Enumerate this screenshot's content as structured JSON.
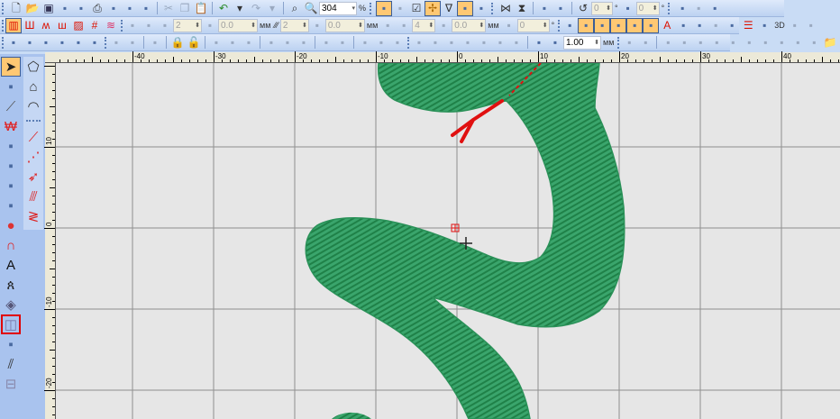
{
  "toolbars": [
    [
      {
        "g": 1
      },
      {
        "i": "new-file-icon"
      },
      {
        "i": "open-folder-icon"
      },
      {
        "i": "save-icon"
      },
      {
        "i": "export-icon"
      },
      {
        "i": "import-icon"
      },
      {
        "i": "print-icon"
      },
      {
        "i": "print-preview-icon"
      },
      {
        "i": "properties-icon"
      },
      {
        "i": "stitch-list-icon"
      },
      {
        "s": 1
      },
      {
        "i": "cut-icon",
        "d": 1
      },
      {
        "i": "copy-icon",
        "d": 1
      },
      {
        "i": "paste-icon",
        "d": 1
      },
      {
        "s": 1
      },
      {
        "i": "undo-icon"
      },
      {
        "i": "dropdown-arrow-icon"
      },
      {
        "i": "redo-icon",
        "d": 1
      },
      {
        "i": "dropdown-arrow-icon",
        "d": 1
      },
      {
        "s": 1
      },
      {
        "i": "zoom-fit-icon"
      },
      {
        "i": "zoom-icon"
      },
      {
        "in": "304",
        "w": 42,
        "a": 1,
        "dd": 1
      },
      {
        "l": "%"
      },
      {
        "g": 1
      },
      {
        "i": "show-design-icon",
        "on": 1
      },
      {
        "i": "show-points-icon",
        "d": 1
      },
      {
        "i": "checkbox-icon"
      },
      {
        "i": "needle-icon",
        "on": 1
      },
      {
        "i": "filter-icon"
      },
      {
        "i": "node-icon",
        "on": 1
      },
      {
        "i": "palette-icon"
      },
      {
        "g": 1
      },
      {
        "i": "mirror-horizontal-icon"
      },
      {
        "i": "mirror-vertical-icon"
      },
      {
        "s": 1
      },
      {
        "i": "skew-icon"
      },
      {
        "i": "skew-2-icon"
      },
      {
        "s": 1
      },
      {
        "i": "rotate-icon"
      },
      {
        "in": "0",
        "w": 24
      },
      {
        "l": "°"
      },
      {
        "i": "slant-icon"
      },
      {
        "in": "0",
        "w": 26
      },
      {
        "l": "°"
      },
      {
        "g": 1
      },
      {
        "i": "layout-icon"
      },
      {
        "i": "page-icon",
        "d": 1
      },
      {
        "i": "report-icon"
      }
    ],
    [
      {
        "g": 1
      },
      {
        "i": "satin-icon",
        "on": 1
      },
      {
        "i": "fill-satin-icon"
      },
      {
        "i": "zigzag-icon"
      },
      {
        "i": "running-icon"
      },
      {
        "i": "pattern-fill-icon"
      },
      {
        "i": "cross-hatch-icon"
      },
      {
        "i": "contour-icon"
      },
      {
        "g": 1
      },
      {
        "i": "angle-icon",
        "d": 1
      },
      {
        "i": "outline-icon",
        "d": 1
      },
      {
        "i": "density-icon",
        "d": 1
      },
      {
        "in": "2",
        "w": 32
      },
      {
        "i": "height-icon",
        "d": 1
      },
      {
        "in": "0.0",
        "w": 44
      },
      {
        "l": "мм"
      },
      {
        "l": "⁄⁄⁄"
      },
      {
        "in": "2",
        "w": 32
      },
      {
        "i": "spacing-icon",
        "d": 1
      },
      {
        "in": "0.0",
        "w": 44
      },
      {
        "l": "мм"
      },
      {
        "i": "offset-icon",
        "d": 1
      },
      {
        "i": "spread-icon",
        "d": 1
      },
      {
        "in": "4",
        "w": 26
      },
      {
        "i": "pull-icon",
        "d": 1
      },
      {
        "in": "0.0",
        "w": 38
      },
      {
        "l": "мм"
      },
      {
        "i": "angle-2-icon",
        "d": 1
      },
      {
        "in": "0",
        "w": 36
      },
      {
        "l": "°"
      },
      {
        "g": 1
      },
      {
        "i": "underlay-icon"
      },
      {
        "i": "underlay-edge-icon",
        "on": 1
      },
      {
        "i": "underlay-grid-icon",
        "on": 1
      },
      {
        "i": "underlay-zigzag-icon",
        "on": 1
      },
      {
        "i": "underlay-double-icon",
        "on": 1
      },
      {
        "i": "underlay-tatami-icon",
        "on": 1
      },
      {
        "i": "lettering-a-icon"
      },
      {
        "i": "jump-icon"
      },
      {
        "i": "wave-icon"
      },
      {
        "i": "column-icon",
        "d": 1
      },
      {
        "i": "grid-red-icon"
      },
      {
        "i": "lines-icon"
      },
      {
        "i": "texture-icon"
      },
      {
        "l": "3D"
      },
      {
        "i": "view-icon",
        "d": 1
      },
      {
        "i": "machine-icon",
        "d": 1
      }
    ],
    [
      {
        "g": 1
      },
      {
        "i": "stitch-view-icon"
      },
      {
        "i": "frame-view-icon"
      },
      {
        "i": "thread-view-icon"
      },
      {
        "i": "center-icon"
      },
      {
        "i": "background-icon"
      },
      {
        "i": "machine-view-icon"
      },
      {
        "g": 1
      },
      {
        "i": "group-icon",
        "d": 1
      },
      {
        "i": "ungroup-icon",
        "d": 1
      },
      {
        "s": 1
      },
      {
        "i": "link-icon",
        "d": 1
      },
      {
        "s": 1
      },
      {
        "i": "lock-icon",
        "d": 1
      },
      {
        "i": "unlock-icon",
        "d": 1
      },
      {
        "s": 1
      },
      {
        "i": "align-left-icon",
        "d": 1
      },
      {
        "i": "align-center-icon",
        "d": 1
      },
      {
        "i": "align-right-icon",
        "d": 1
      },
      {
        "s": 1
      },
      {
        "i": "align-top-icon",
        "d": 1
      },
      {
        "i": "align-middle-icon",
        "d": 1
      },
      {
        "i": "align-bottom-icon",
        "d": 1
      },
      {
        "s": 1
      },
      {
        "i": "distribute-h-icon",
        "d": 1
      },
      {
        "i": "distribute-v-icon",
        "d": 1
      },
      {
        "s": 1
      },
      {
        "i": "same-width-icon",
        "d": 1
      },
      {
        "i": "same-height-icon",
        "d": 1
      },
      {
        "i": "same-size-icon",
        "d": 1
      },
      {
        "g": 1
      },
      {
        "i": "order-front-icon",
        "d": 1
      },
      {
        "i": "order-back-icon",
        "d": 1
      },
      {
        "i": "order-forward-icon",
        "d": 1
      },
      {
        "i": "order-backward-icon",
        "d": 1
      },
      {
        "i": "order-5-icon",
        "d": 1
      },
      {
        "i": "order-6-icon",
        "d": 1
      },
      {
        "i": "order-7-icon",
        "d": 1
      },
      {
        "s": 1
      },
      {
        "i": "start-point-icon"
      },
      {
        "i": "end-point-icon"
      },
      {
        "in": "1.00",
        "w": 42,
        "a": 1,
        "sp": 1
      },
      {
        "l": "мм"
      },
      {
        "g": 1
      },
      {
        "i": "hoop-icon",
        "d": 1
      },
      {
        "i": "monitor-icon",
        "d": 1
      },
      {
        "s": 1
      },
      {
        "i": "view-1-icon",
        "d": 1
      },
      {
        "i": "view-2-icon",
        "d": 1
      },
      {
        "i": "view-3-icon",
        "d": 1
      },
      {
        "i": "view-4-icon",
        "d": 1
      },
      {
        "i": "view-5-icon",
        "d": 1
      },
      {
        "i": "view-6-icon",
        "d": 1
      },
      {
        "i": "view-7-icon",
        "d": 1
      },
      {
        "i": "view-8-icon",
        "d": 1
      },
      {
        "i": "view-9-icon",
        "d": 1
      },
      {
        "i": "view-10-icon",
        "d": 1
      },
      {
        "i": "folder-icon"
      }
    ]
  ],
  "left_tools_col1": [
    "select-arrow-icon",
    "reshape-icon",
    "knife-icon",
    "stitch-edit-icon",
    "transform-icon",
    "polygon-node-icon",
    "running-line-icon",
    "polyline-icon",
    "satin-fill-icon",
    "arc-icon",
    "lettering-icon",
    "monogram-icon",
    "applique-icon",
    "offset-outline-icon",
    "auto-digitize-icon",
    "parallel-lines-icon",
    "split-icon"
  ],
  "left_tools_col2": [
    "polygon-icon",
    "closed-shape-icon",
    "column-shape-icon",
    "run-1-icon",
    "run-3-icon",
    "triple-run-icon",
    "satin-line-icon",
    "zigzag-line-icon"
  ],
  "left_selected": "offset-outline-icon",
  "ruler": {
    "h": [
      "-40",
      "-30",
      "-20",
      "-10",
      "0",
      "10",
      "20",
      "30",
      "40"
    ],
    "v": [
      "10",
      "0",
      "-10",
      "-20"
    ]
  },
  "colors": {
    "thread_green": "#2e9a60",
    "thread_red": "#e01010",
    "canvas": "#e6e6e6",
    "toolbar": "#c9dcf5",
    "active": "#ffc873"
  }
}
